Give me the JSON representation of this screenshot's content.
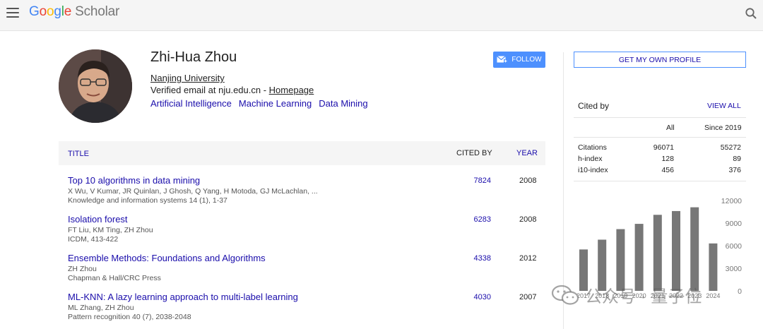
{
  "header": {
    "logo_google": [
      "G",
      "o",
      "o",
      "g",
      "l",
      "e"
    ],
    "logo_scholar": "Scholar"
  },
  "profile": {
    "name": "Zhi-Hua Zhou",
    "affiliation": "Nanjing University",
    "email_text": "Verified email at nju.edu.cn - ",
    "homepage_label": "Homepage",
    "interests": [
      "Artificial Intelligence",
      "Machine Learning",
      "Data Mining"
    ],
    "follow_label": "FOLLOW"
  },
  "table": {
    "col_title": "TITLE",
    "col_cited": "CITED BY",
    "col_year": "YEAR",
    "articles": [
      {
        "title": "Top 10 algorithms in data mining",
        "authors": "X Wu, V Kumar, JR Quinlan, J Ghosh, Q Yang, H Motoda, GJ McLachlan, ...",
        "venue": "Knowledge and information systems 14 (1), 1-37",
        "cited": "7824",
        "year": "2008"
      },
      {
        "title": "Isolation forest",
        "authors": "FT Liu, KM Ting, ZH Zhou",
        "venue": "ICDM, 413-422",
        "cited": "6283",
        "year": "2008"
      },
      {
        "title": "Ensemble Methods: Foundations and Algorithms",
        "authors": "ZH Zhou",
        "venue": "Chapman & Hall/CRC Press",
        "cited": "4338",
        "year": "2012"
      },
      {
        "title": "ML-KNN: A lazy learning approach to multi-label learning",
        "authors": "ML Zhang, ZH Zhou",
        "venue": "Pattern recognition 40 (7), 2038-2048",
        "cited": "4030",
        "year": "2007"
      }
    ]
  },
  "sidebar": {
    "own_profile_label": "GET MY OWN PROFILE",
    "cited_by_label": "Cited by",
    "view_all_label": "VIEW ALL",
    "col_all": "All",
    "col_since": "Since 2019",
    "stats": [
      {
        "label": "Citations",
        "all": "96071",
        "since": "55272"
      },
      {
        "label": "h-index",
        "all": "128",
        "since": "89"
      },
      {
        "label": "i10-index",
        "all": "456",
        "since": "376"
      }
    ]
  },
  "chart_data": {
    "type": "bar",
    "categories": [
      "2017",
      "2018",
      "2019",
      "2020",
      "2021",
      "2022",
      "2023",
      "2024"
    ],
    "values": [
      5500,
      6800,
      8200,
      8900,
      10100,
      10600,
      11100,
      6300
    ],
    "ylim": [
      0,
      12000
    ],
    "yticks": [
      "12000",
      "9000",
      "6000",
      "3000",
      "0"
    ],
    "bar_color": "#777777"
  },
  "watermark": {
    "text": "公众号 · 量子位"
  },
  "colors": {
    "link": "#1a0dab",
    "button": "#4d90fe",
    "topbar": "#f5f5f5"
  }
}
